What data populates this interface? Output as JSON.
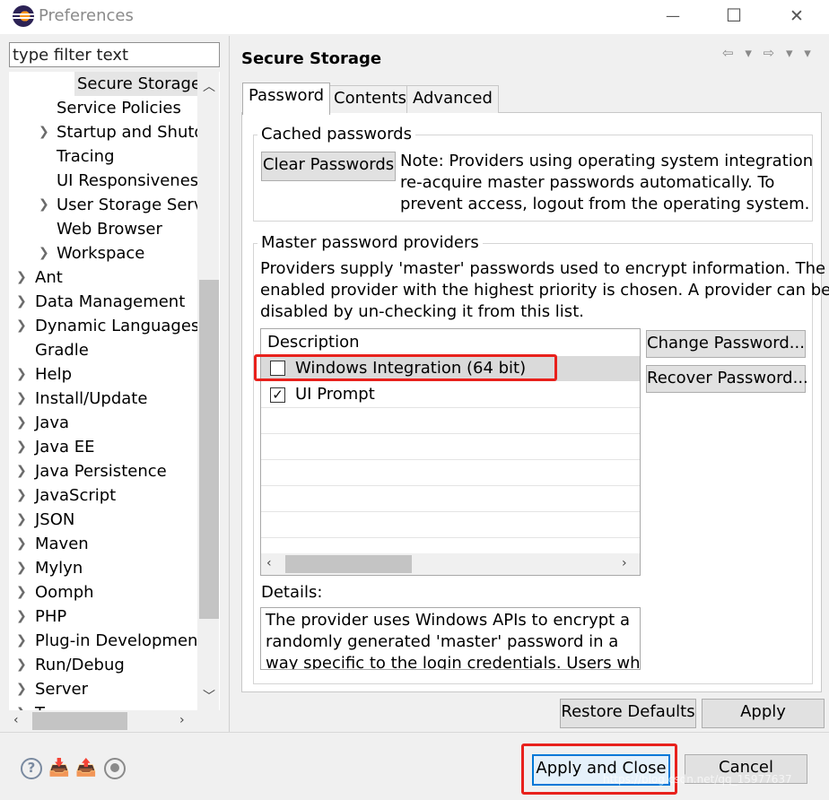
{
  "window": {
    "title": "Preferences",
    "minimize_glyph": "—",
    "maximize_glyph": "☐",
    "close_glyph": "✕"
  },
  "filter": {
    "placeholder": "type filter text"
  },
  "tree": {
    "items": [
      {
        "label": "Secure Storage",
        "expandable": false,
        "selected": true
      },
      {
        "label": "Service Policies",
        "expandable": false
      },
      {
        "label": "Startup and Shutd",
        "expandable": true
      },
      {
        "label": "Tracing",
        "expandable": false
      },
      {
        "label": "UI Responsiveness",
        "expandable": false
      },
      {
        "label": "User Storage Servi",
        "expandable": true
      },
      {
        "label": "Web Browser",
        "expandable": false
      },
      {
        "label": "Workspace",
        "expandable": true
      },
      {
        "label": "Ant",
        "expandable": true
      },
      {
        "label": "Data Management",
        "expandable": true
      },
      {
        "label": "Dynamic Languages",
        "expandable": true
      },
      {
        "label": "Gradle",
        "expandable": false
      },
      {
        "label": "Help",
        "expandable": true
      },
      {
        "label": "Install/Update",
        "expandable": true
      },
      {
        "label": "Java",
        "expandable": true
      },
      {
        "label": "Java EE",
        "expandable": true
      },
      {
        "label": "Java Persistence",
        "expandable": true
      },
      {
        "label": "JavaScript",
        "expandable": true
      },
      {
        "label": "JSON",
        "expandable": true
      },
      {
        "label": "Maven",
        "expandable": true
      },
      {
        "label": "Mylyn",
        "expandable": true
      },
      {
        "label": "Oomph",
        "expandable": true
      },
      {
        "label": "PHP",
        "expandable": true
      },
      {
        "label": "Plug-in Development",
        "expandable": true
      },
      {
        "label": "Run/Debug",
        "expandable": true
      },
      {
        "label": "Server",
        "expandable": true
      },
      {
        "label": "T",
        "expandable": true
      }
    ]
  },
  "page": {
    "title": "Secure Storage",
    "nav_glyphs": "⇦ ▾ ⇨ ▾ ▾"
  },
  "tabs": [
    "Password",
    "Contents",
    "Advanced"
  ],
  "cached": {
    "group_title": "Cached passwords",
    "clear_button": "Clear Passwords",
    "note_lines": [
      "Note: Providers using operating system integration",
      "re-acquire master passwords automatically. To",
      "prevent access, logout from the operating system."
    ]
  },
  "master": {
    "group_title": "Master password providers",
    "description_lines": [
      "Providers supply 'master' passwords used to encrypt information. The",
      "enabled provider with the highest priority is chosen. A provider can be",
      "disabled by un-checking it from this list."
    ],
    "table_header": "Description",
    "providers": [
      {
        "label": "Windows Integration (64 bit)",
        "checked": false
      },
      {
        "label": "UI Prompt",
        "checked": true
      }
    ],
    "change_button": "Change Password...",
    "recover_button": "Recover Password...",
    "details_label": "Details:",
    "details_lines": [
      "The provider uses Windows APIs to encrypt a",
      "randomly generated 'master' password in a",
      "way specific to the login credentials. Users who"
    ]
  },
  "buttons": {
    "restore_defaults": "Restore Defaults",
    "apply": "Apply",
    "apply_and_close": "Apply and Close",
    "cancel": "Cancel"
  },
  "bottom_icons": [
    "help-icon",
    "import-icon",
    "export-icon",
    "record-icon"
  ],
  "watermark": "https://blog.csdn.net/qq_15977637",
  "colors": {
    "highlight_red": "#e8211c",
    "selection_gray": "#dadada"
  }
}
